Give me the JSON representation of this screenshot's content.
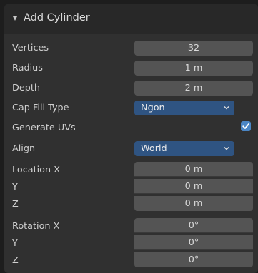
{
  "panel": {
    "title": "Add Cylinder"
  },
  "properties": {
    "vertices": {
      "label": "Vertices",
      "value": "32"
    },
    "radius": {
      "label": "Radius",
      "value": "1 m"
    },
    "depth": {
      "label": "Depth",
      "value": "2 m"
    },
    "cap_fill_type": {
      "label": "Cap Fill Type",
      "value": "Ngon"
    },
    "generate_uvs": {
      "label": "Generate UVs",
      "checked": true
    },
    "align": {
      "label": "Align",
      "value": "World"
    },
    "location": {
      "x_label": "Location X",
      "x_value": "0 m",
      "y_label": "Y",
      "y_value": "0 m",
      "z_label": "Z",
      "z_value": "0 m"
    },
    "rotation": {
      "x_label": "Rotation X",
      "x_value": "0°",
      "y_label": "Y",
      "y_value": "0°",
      "z_label": "Z",
      "z_value": "0°"
    }
  },
  "icons": {
    "collapse": "disclosure-triangle-down-icon",
    "dropdown": "chevron-down-icon",
    "check": "checkmark-icon"
  },
  "colors": {
    "accent": "#4b86c5",
    "dropdown_bg": "#2f5482",
    "field_bg": "#545454",
    "panel_bg": "#303030"
  }
}
